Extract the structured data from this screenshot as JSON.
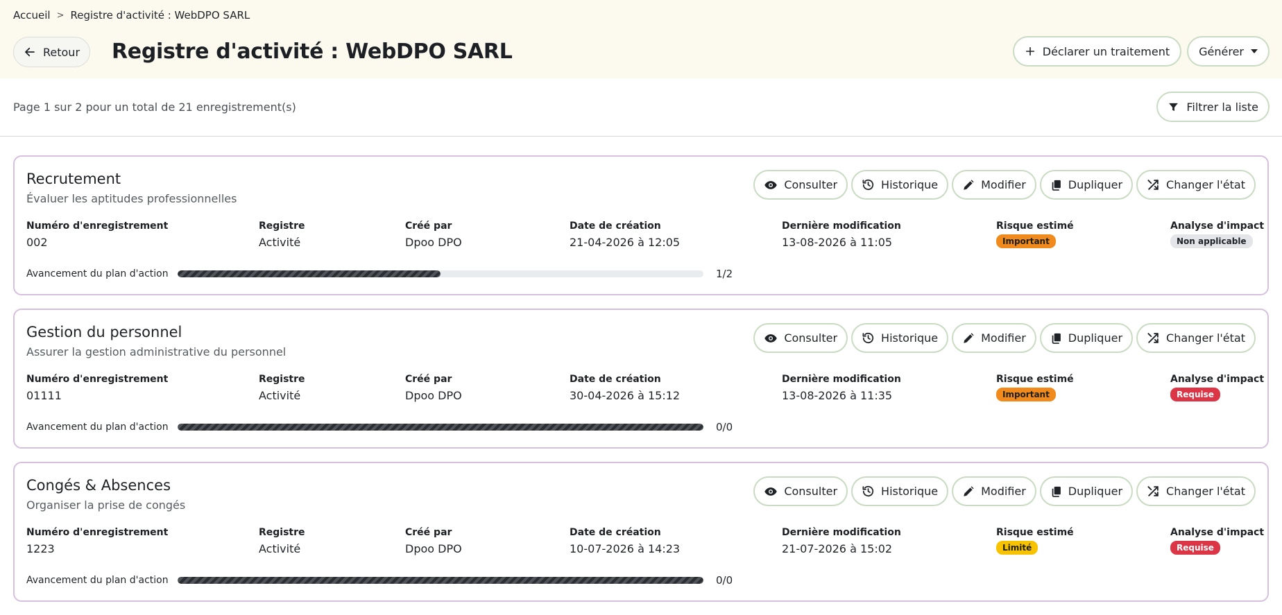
{
  "breadcrumb": {
    "home": "Accueil",
    "separator": ">",
    "current": "Registre d'activité : WebDPO SARL"
  },
  "header": {
    "back_label": "Retour",
    "title": "Registre d'activité : WebDPO SARL",
    "declare_label": "Déclarer un traitement",
    "generate_label": "Générer"
  },
  "toolbar": {
    "page_info": "Page 1 sur 2 pour un total de 21 enregistrement(s)",
    "filter_label": "Filtrer la liste"
  },
  "actions": {
    "consult": "Consulter",
    "history": "Historique",
    "edit": "Modifier",
    "duplicate": "Dupliquer",
    "change_state": "Changer l'état"
  },
  "field_labels": {
    "number": "Numéro d'enregistrement",
    "register": "Registre",
    "created_by": "Créé par",
    "created_at": "Date de création",
    "modified_at": "Dernière modification",
    "risk": "Risque estimé",
    "impact": "Analyse d'impact",
    "progress": "Avancement du plan d'action"
  },
  "records": [
    {
      "title": "Recrutement",
      "subtitle": "Évaluer les aptitudes professionnelles",
      "number": "002",
      "register": "Activité",
      "created_by": "Dpoo DPO",
      "created_at": "21-04-2026 à 12:05",
      "modified_at": "13-08-2026 à 11:05",
      "risk": "Important",
      "risk_level": "important",
      "impact": "Non applicable",
      "impact_level": "na",
      "progress_done": 1,
      "progress_total": 2,
      "progress_count": "1/2"
    },
    {
      "title": "Gestion du personnel",
      "subtitle": "Assurer la gestion administrative du personnel",
      "number": "01111",
      "register": "Activité",
      "created_by": "Dpoo DPO",
      "created_at": "30-04-2026 à 15:12",
      "modified_at": "13-08-2026 à 11:35",
      "risk": "Important",
      "risk_level": "important",
      "impact": "Requise",
      "impact_level": "requise",
      "progress_done": 0,
      "progress_total": 0,
      "progress_count": "0/0"
    },
    {
      "title": "Congés & Absences",
      "subtitle": "Organiser la prise de congés",
      "number": "1223",
      "register": "Activité",
      "created_by": "Dpoo DPO",
      "created_at": "10-07-2026 à 14:23",
      "modified_at": "21-07-2026 à 15:02",
      "risk": "Limité",
      "risk_level": "limite",
      "impact": "Requise",
      "impact_level": "requise",
      "progress_done": 0,
      "progress_total": 0,
      "progress_count": "0/0"
    }
  ]
}
